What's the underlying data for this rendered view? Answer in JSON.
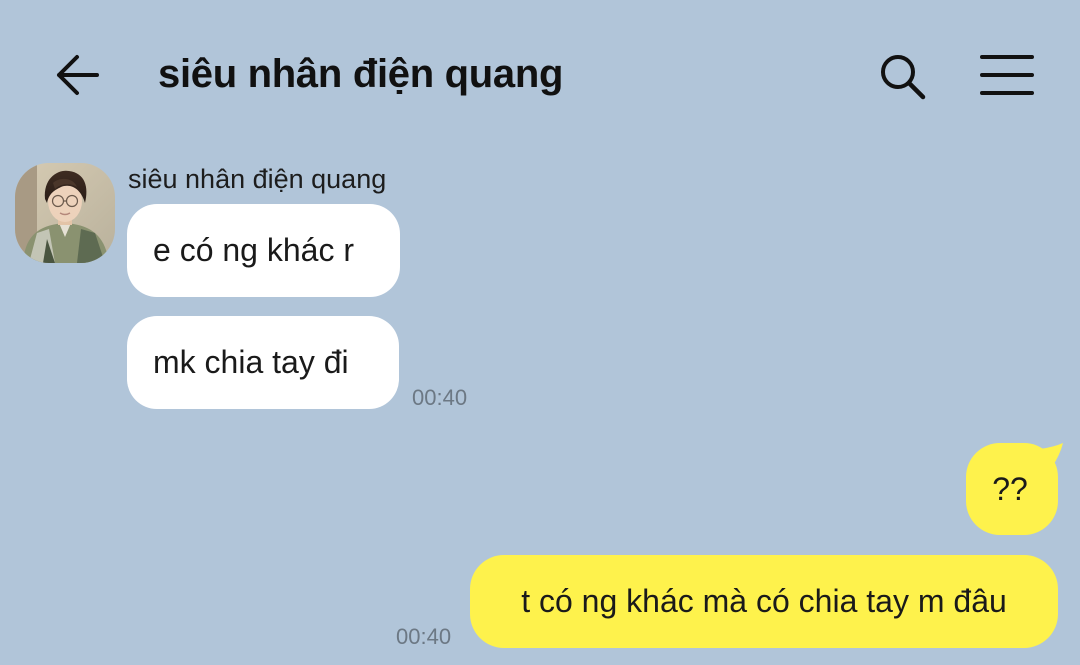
{
  "header": {
    "title": "siêu nhân điện quang",
    "back_icon": "arrow-left-icon",
    "search_icon": "search-icon",
    "menu_icon": "hamburger-menu-icon"
  },
  "colors": {
    "background": "#b1c5d9",
    "incoming_bubble": "#ffffff",
    "outgoing_bubble": "#fef24c",
    "timestamp": "#6c7884"
  },
  "conversation": {
    "sender_name": "siêu nhân điện quang",
    "messages": [
      {
        "direction": "incoming",
        "text": "e có ng khác r"
      },
      {
        "direction": "incoming",
        "text": "mk chia tay đi",
        "time": "00:40"
      },
      {
        "direction": "outgoing",
        "text": "??"
      },
      {
        "direction": "outgoing",
        "text": "t có ng khác mà có chia tay m đâu",
        "time": "00:40"
      }
    ]
  }
}
